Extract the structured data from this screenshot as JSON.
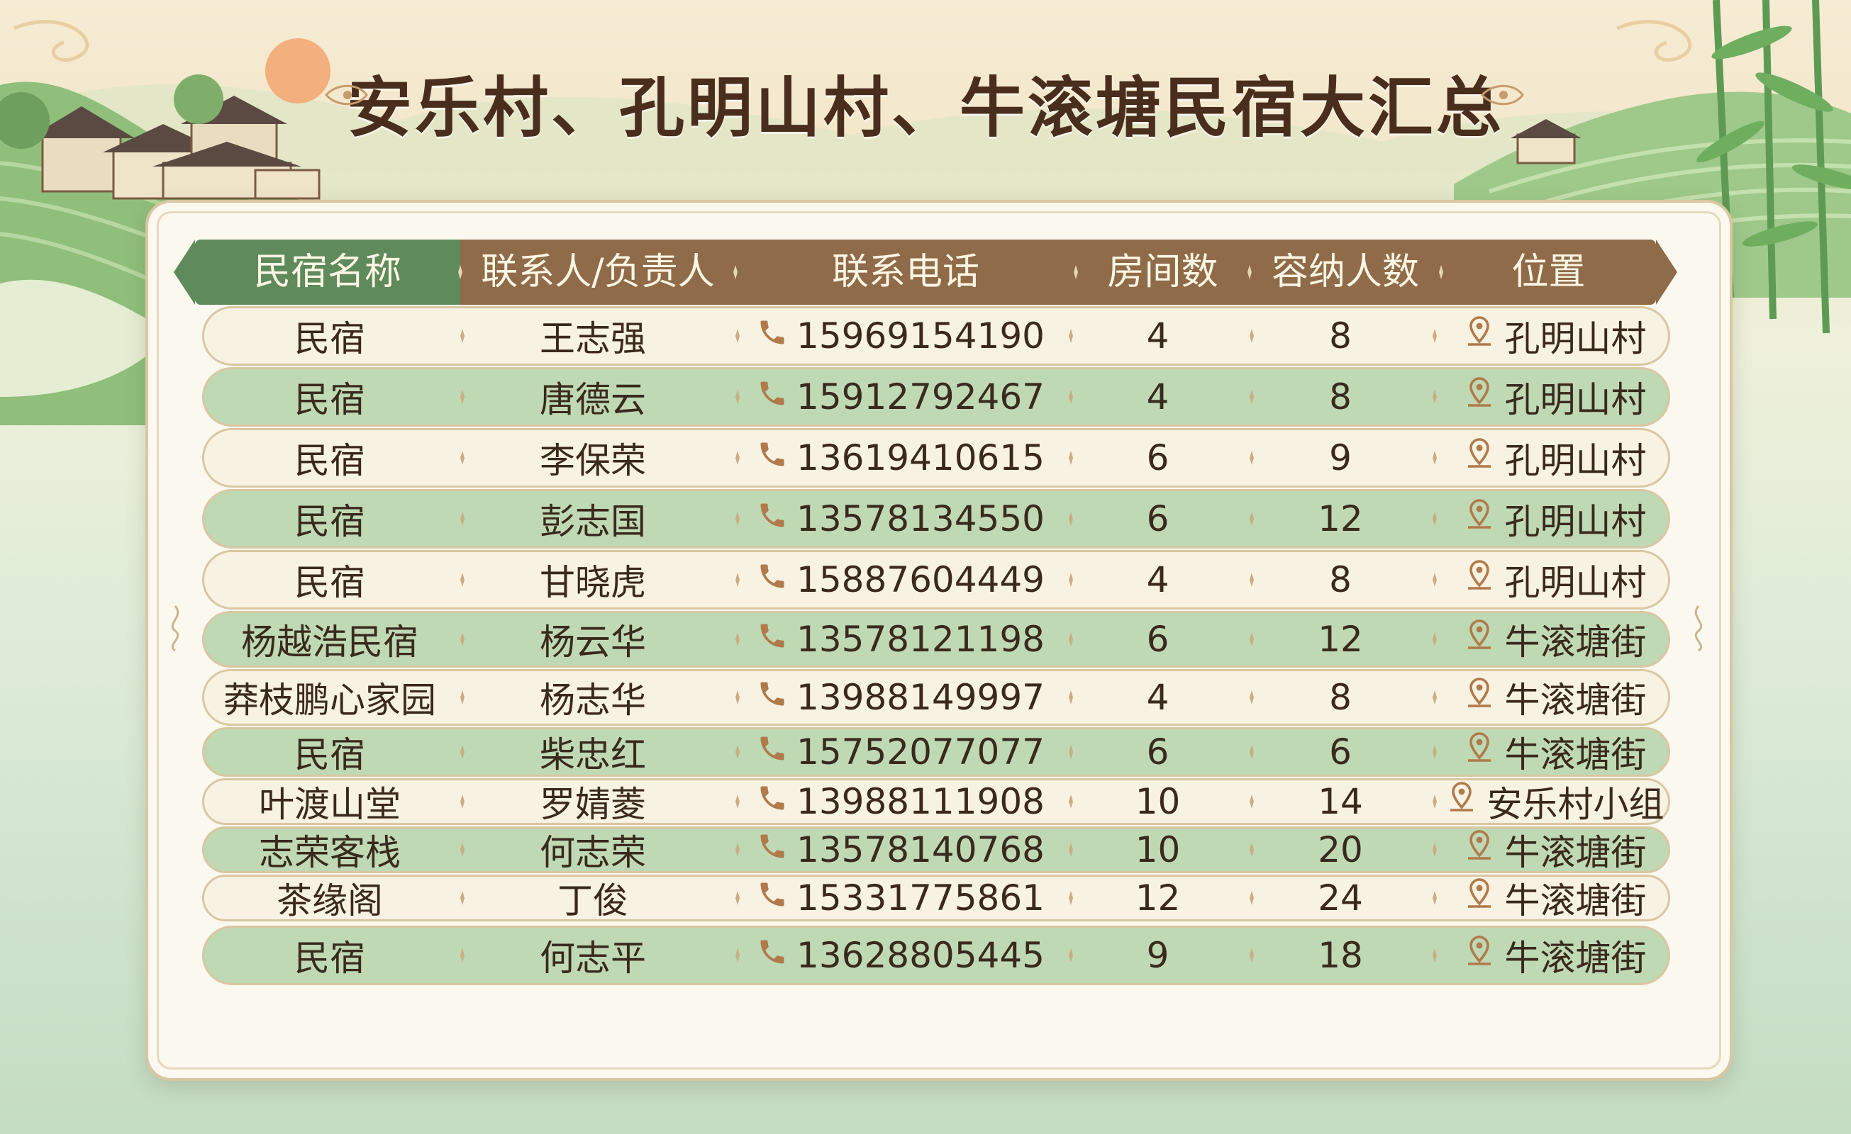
{
  "title": "安乐村、孔明山村、牛滚塘民宿大汇总",
  "colors": {
    "header_brown": "#8f6b49",
    "header_green": "#5f8a5b",
    "row_green": "#bfd9b5",
    "row_cream": "#f8f2e2",
    "text_dark": "#3a2a1c",
    "icon_brown": "#b07a4a"
  },
  "table": {
    "headers": [
      "民宿名称",
      "联系人/负责人",
      "联系电话",
      "房间数",
      "容纳人数",
      "位置"
    ],
    "rows": [
      {
        "name": "民宿",
        "contact": "王志强",
        "phone": "15969154190",
        "rooms": "4",
        "capacity": "8",
        "location": "孔明山村"
      },
      {
        "name": "民宿",
        "contact": "唐德云",
        "phone": "15912792467",
        "rooms": "4",
        "capacity": "8",
        "location": "孔明山村"
      },
      {
        "name": "民宿",
        "contact": "李保荣",
        "phone": "13619410615",
        "rooms": "6",
        "capacity": "9",
        "location": "孔明山村"
      },
      {
        "name": "民宿",
        "contact": "彭志国",
        "phone": "13578134550",
        "rooms": "6",
        "capacity": "12",
        "location": "孔明山村"
      },
      {
        "name": "民宿",
        "contact": "甘晓虎",
        "phone": "15887604449",
        "rooms": "4",
        "capacity": "8",
        "location": "孔明山村"
      },
      {
        "name": "杨越浩民宿",
        "contact": "杨云华",
        "phone": "13578121198",
        "rooms": "6",
        "capacity": "12",
        "location": "牛滚塘街"
      },
      {
        "name": "莽枝鹏心家园",
        "contact": "杨志华",
        "phone": "13988149997",
        "rooms": "4",
        "capacity": "8",
        "location": "牛滚塘街"
      },
      {
        "name": "民宿",
        "contact": "柴忠红",
        "phone": "15752077077",
        "rooms": "6",
        "capacity": "6",
        "location": "牛滚塘街"
      },
      {
        "name": "叶渡山堂",
        "contact": "罗婧菱",
        "phone": "13988111908",
        "rooms": "10",
        "capacity": "14",
        "location": "安乐村小组"
      },
      {
        "name": "志荣客栈",
        "contact": "何志荣",
        "phone": "13578140768",
        "rooms": "10",
        "capacity": "20",
        "location": "牛滚塘街"
      },
      {
        "name": "茶缘阁",
        "contact": "丁俊",
        "phone": "15331775861",
        "rooms": "12",
        "capacity": "24",
        "location": "牛滚塘街"
      },
      {
        "name": "民宿",
        "contact": "何志平",
        "phone": "13628805445",
        "rooms": "9",
        "capacity": "18",
        "location": "牛滚塘街"
      }
    ]
  },
  "icons": {
    "phone": "phone-icon",
    "location": "location-pin-icon",
    "sun": "sun-icon",
    "bamboo": "bamboo-icon",
    "village": "village-houses-icon"
  }
}
